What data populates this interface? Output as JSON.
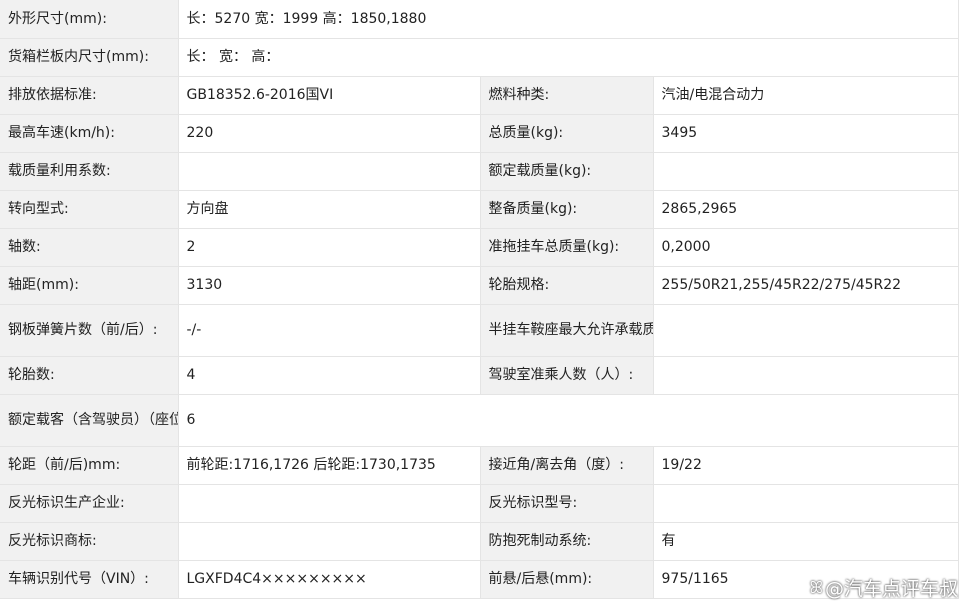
{
  "rows": [
    {
      "full": true,
      "label": "外形尺寸(mm):",
      "value": "长：5270 宽：1999 高：1850,1880"
    },
    {
      "full": true,
      "label": "货箱栏板内尺寸(mm):",
      "value": "长： 宽： 高："
    },
    {
      "l1": "排放依据标准:",
      "v1": "GB18352.6-2016国VI",
      "l2": "燃料种类:",
      "v2": "汽油/电混合动力"
    },
    {
      "l1": "最高车速(km/h):",
      "v1": "220",
      "l2": "总质量(kg):",
      "v2": "3495"
    },
    {
      "l1": "载质量利用系数:",
      "v1": "",
      "l2": "额定载质量(kg):",
      "v2": ""
    },
    {
      "l1": "转向型式:",
      "v1": "方向盘",
      "l2": "整备质量(kg):",
      "v2": "2865,2965"
    },
    {
      "l1": "轴数:",
      "v1": "2",
      "l2": "准拖挂车总质量(kg):",
      "v2": "0,2000"
    },
    {
      "l1": "轴距(mm):",
      "v1": "3130",
      "l2": "轮胎规格:",
      "v2": "255/50R21,255/45R22/275/45R22"
    },
    {
      "l1": "钢板弹簧片数（前/后）:",
      "v1": "-/-",
      "l2": "半挂车鞍座最大允许承载质量(kg):",
      "v2": ""
    },
    {
      "l1": "轮胎数:",
      "v1": "4",
      "l2": "驾驶室准乘人数（人）:",
      "v2": ""
    },
    {
      "full": true,
      "label": "额定载客（含驾驶员）（座位数）:",
      "value": "6"
    },
    {
      "l1": "轮距（前/后)mm:",
      "v1": "前轮距:1716,1726 后轮距:1730,1735",
      "l2": "接近角/离去角（度）:",
      "v2": "19/22"
    },
    {
      "l1": "反光标识生产企业:",
      "v1": "",
      "l2": "反光标识型号:",
      "v2": ""
    },
    {
      "l1": "反光标识商标:",
      "v1": "",
      "l2": "防抱死制动系统:",
      "v2": "有"
    },
    {
      "l1": "车辆识别代号（VIN）:",
      "v1": "LGXFD4C4×××××××××",
      "l2": "前悬/后悬(mm):",
      "v2": "975/1165"
    }
  ],
  "watermark": {
    "icon": "weibo-icon",
    "text": "@汽车点评车叔"
  }
}
